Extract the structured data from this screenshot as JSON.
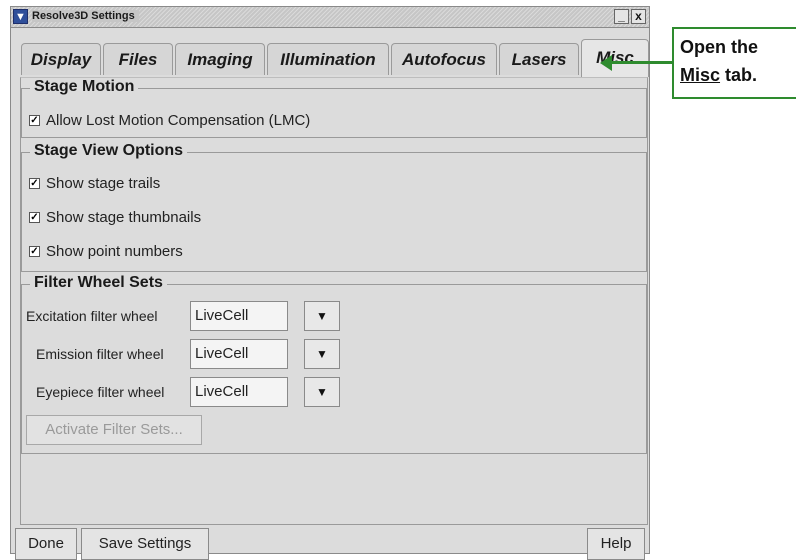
{
  "window": {
    "title": "Resolve3D Settings",
    "minimize_glyph": "_",
    "close_glyph": "x",
    "menu_icon": "chevron-down-icon"
  },
  "tabs": [
    {
      "label": "Display",
      "active": false
    },
    {
      "label": "Files",
      "active": false
    },
    {
      "label": "Imaging",
      "active": false
    },
    {
      "label": "Illumination",
      "active": false
    },
    {
      "label": "Autofocus",
      "active": false
    },
    {
      "label": "Lasers",
      "active": false
    },
    {
      "label": "Misc",
      "active": true
    }
  ],
  "stage_motion": {
    "title": "Stage Motion",
    "options": [
      {
        "label": "Allow Lost Motion Compensation (LMC)",
        "checked": true
      }
    ]
  },
  "stage_view": {
    "title": "Stage View Options",
    "options": [
      {
        "label": "Show stage trails",
        "checked": true
      },
      {
        "label": "Show stage thumbnails",
        "checked": true
      },
      {
        "label": "Show point numbers",
        "checked": true
      }
    ]
  },
  "filter_wheel": {
    "title": "Filter Wheel Sets",
    "rows": [
      {
        "label": "Excitation filter wheel",
        "value": "LiveCell"
      },
      {
        "label": "Emission filter wheel",
        "value": "LiveCell"
      },
      {
        "label": "Eyepiece filter wheel",
        "value": "LiveCell"
      }
    ],
    "activate_label": "Activate Filter Sets..."
  },
  "footer": {
    "done_label": "Done",
    "save_label": "Save Settings",
    "help_label": "Help"
  },
  "callout": {
    "line1": "Open the",
    "line2_underlined": "Misc",
    "line2_rest": " tab."
  },
  "colors": {
    "accent_green": "#2e8b2e",
    "window_bg": "#dcdcdc"
  }
}
